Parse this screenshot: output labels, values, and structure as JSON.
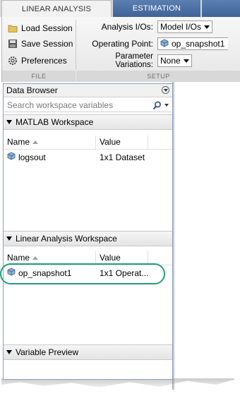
{
  "tabs": {
    "active": "LINEAR ANALYSIS",
    "second": "ESTIMATION"
  },
  "file_group": {
    "load_label": "Load Session",
    "save_label": "Save Session",
    "prefs_label": "Preferences",
    "group_label": "FILE"
  },
  "setup_group": {
    "analysis_ios_label": "Analysis I/Os:",
    "analysis_ios_value": "Model I/Os",
    "operating_point_label": "Operating Point:",
    "operating_point_value": "op_snapshot1",
    "param_var_label": "Parameter Variations:",
    "param_var_value": "None",
    "group_label": "SETUP"
  },
  "data_browser": {
    "title": "Data Browser",
    "search_placeholder": "Search workspace variables",
    "matlab_ws": {
      "title": "MATLAB Workspace",
      "col_name": "Name",
      "col_value": "Value",
      "rows": [
        {
          "name": "logsout",
          "value": "1x1 Dataset"
        }
      ]
    },
    "linear_ws": {
      "title": "Linear Analysis Workspace",
      "col_name": "Name",
      "col_value": "Value",
      "rows": [
        {
          "name": "op_snapshot1",
          "value": "1x1 Operat..."
        }
      ]
    },
    "variable_preview": {
      "title": "Variable Preview"
    }
  },
  "colors": {
    "tab_blue": "#4a6fa5",
    "highlight": "#21a07f"
  }
}
